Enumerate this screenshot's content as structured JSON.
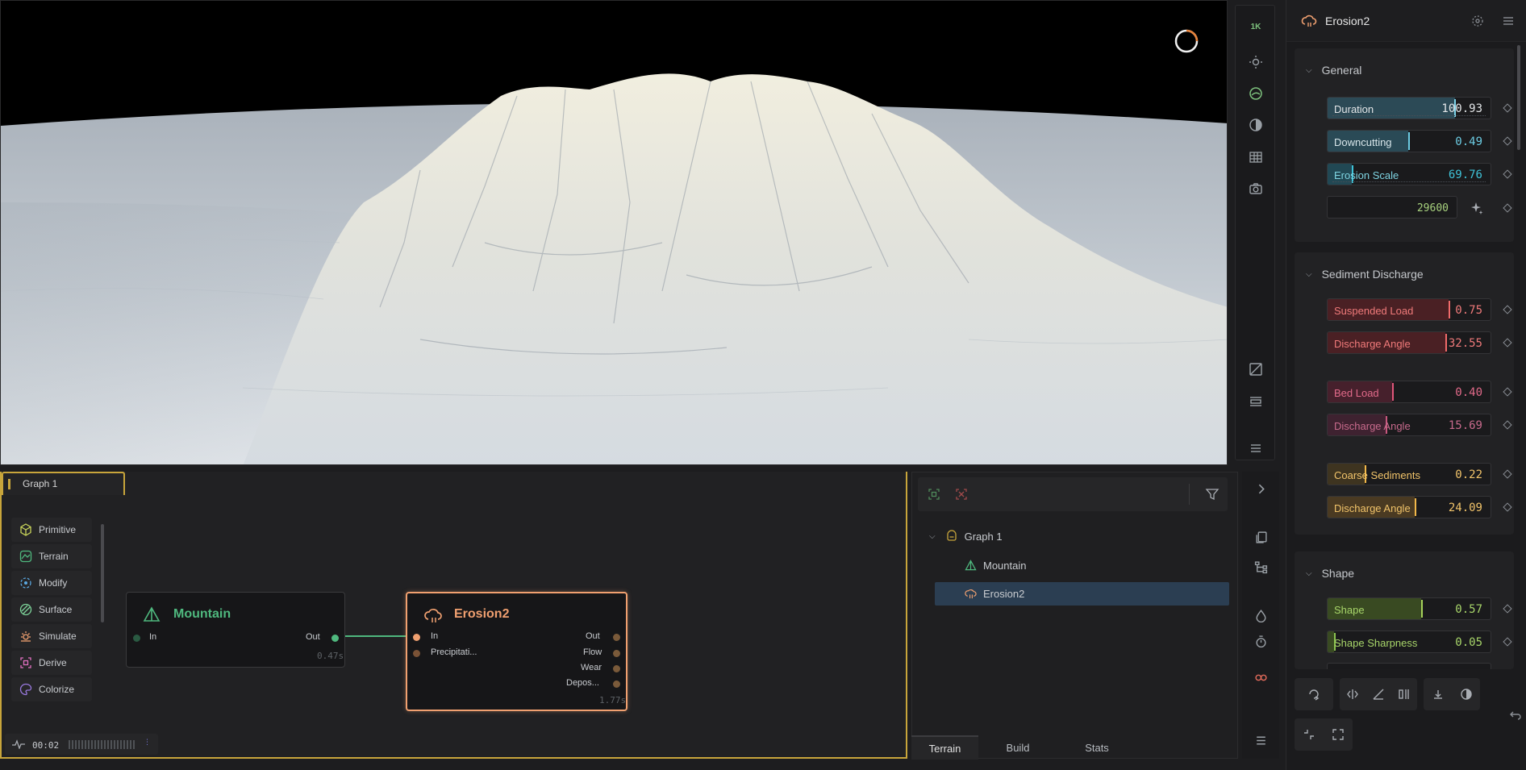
{
  "viewport": {
    "resolution_badge": "1K"
  },
  "properties": {
    "node_title": "Erosion2",
    "sections": [
      {
        "title": "General",
        "params": [
          {
            "label": "Duration",
            "value": "100.93"
          },
          {
            "label": "Downcutting",
            "value": "0.49"
          },
          {
            "label": "Erosion Scale",
            "value": "69.76"
          }
        ],
        "seed": "29600"
      },
      {
        "title": "Sediment Discharge",
        "params": [
          {
            "label": "Suspended Load",
            "value": "0.75"
          },
          {
            "label": "Discharge Angle",
            "value": "32.55"
          },
          {
            "label": "Bed Load",
            "value": "0.40"
          },
          {
            "label": "Discharge Angle",
            "value": "15.69"
          },
          {
            "label": "Coarse Sediments",
            "value": "0.22"
          },
          {
            "label": "Discharge Angle",
            "value": "24.09"
          }
        ]
      },
      {
        "title": "Shape",
        "params": [
          {
            "label": "Shape",
            "value": "0.57"
          },
          {
            "label": "Shape Sharpness",
            "value": "0.05"
          }
        ]
      }
    ]
  },
  "graph": {
    "tab_label": "Graph 1",
    "palette": [
      "Primitive",
      "Terrain",
      "Modify",
      "Surface",
      "Simulate",
      "Derive",
      "Colorize"
    ],
    "nodes": {
      "mountain": {
        "title": "Mountain",
        "inputs": [
          "In"
        ],
        "outputs": [
          "Out"
        ],
        "time": "0.47s"
      },
      "erosion": {
        "title": "Erosion2",
        "inputs": [
          "In",
          "Precipitati..."
        ],
        "outputs": [
          "Out",
          "Flow",
          "Wear",
          "Depos..."
        ],
        "time": "1.77s"
      }
    },
    "status_time": "00:02"
  },
  "hierarchy": {
    "root": "Graph 1",
    "items": [
      "Mountain",
      "Erosion2"
    ],
    "tabs": [
      "Terrain",
      "Build",
      "Stats"
    ]
  },
  "colors": {
    "accent_gold": "#c8a53b",
    "mountain_green": "#4fb87e",
    "erosion_orange": "#f0a070",
    "selection_blue": "#2b3e52"
  }
}
